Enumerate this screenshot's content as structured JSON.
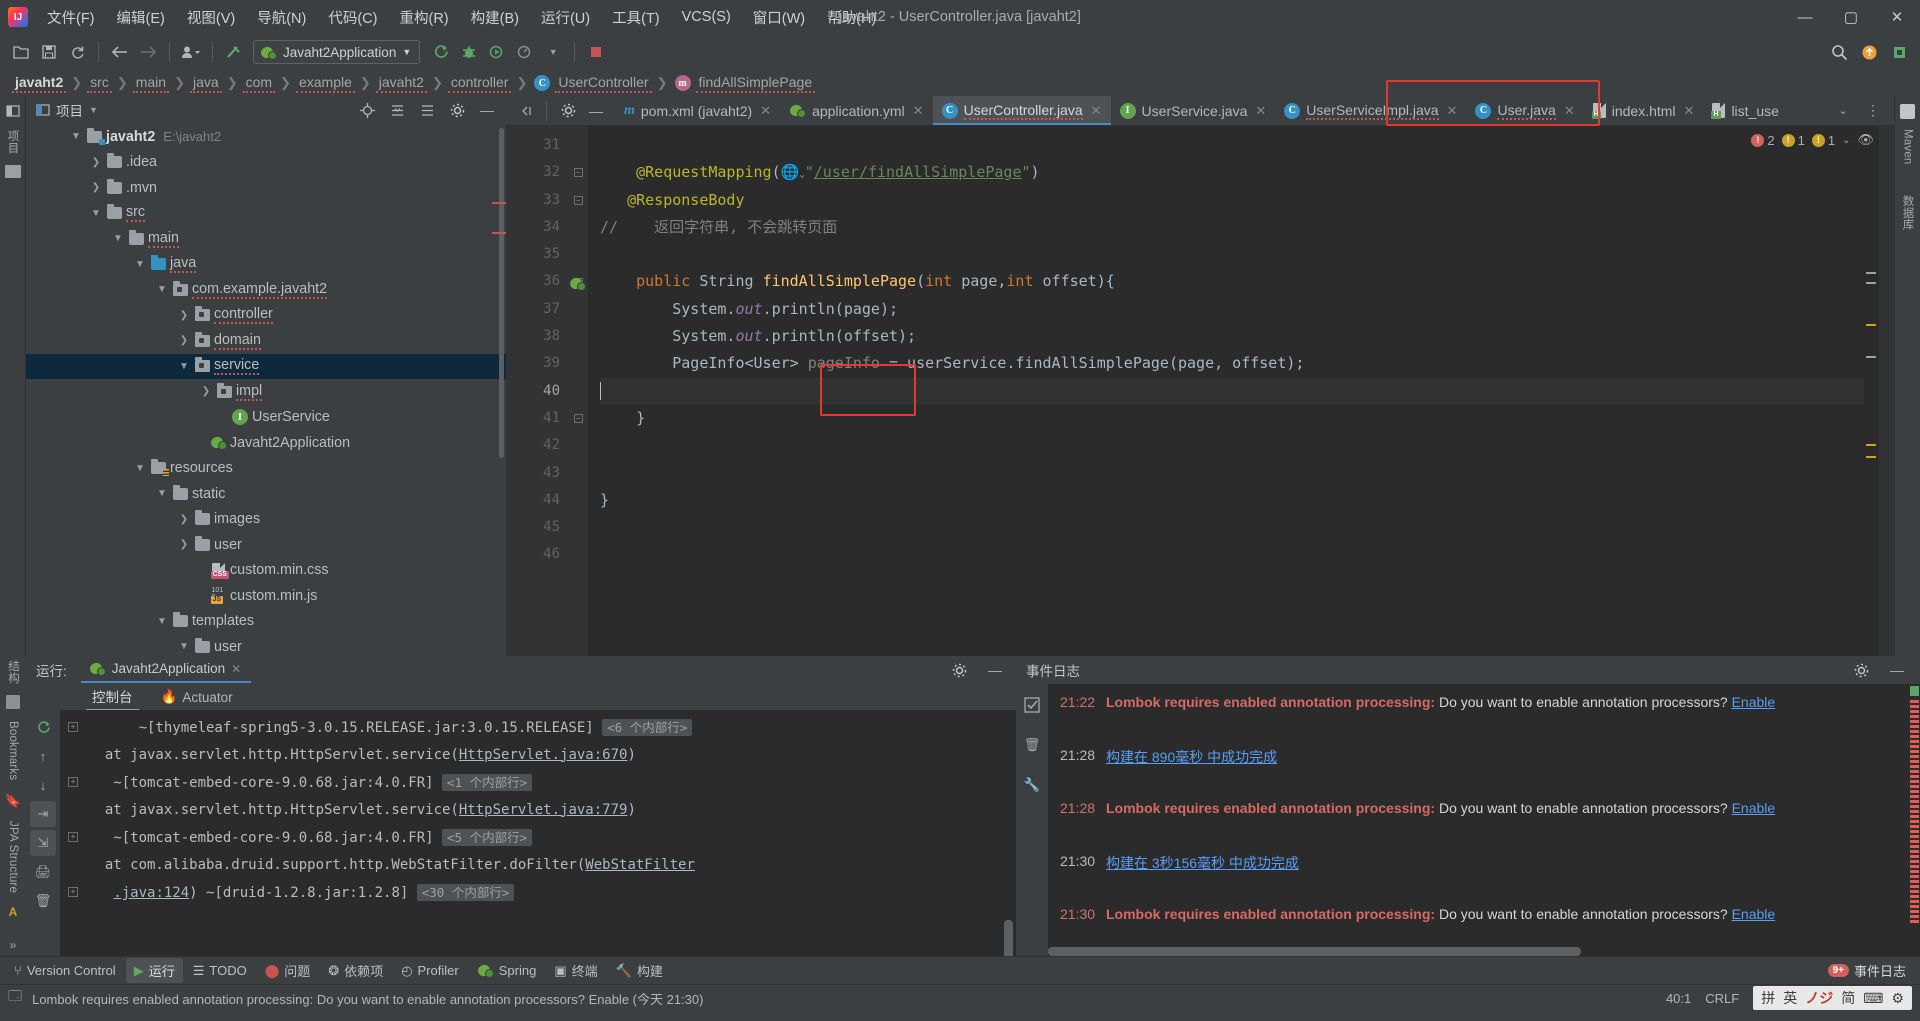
{
  "window": {
    "title": "javaht2 - UserController.java [javaht2]",
    "minimize": "—",
    "maximize": "▢",
    "close": "✕"
  },
  "menu": [
    {
      "label": "文件(F)"
    },
    {
      "label": "编辑(E)"
    },
    {
      "label": "视图(V)"
    },
    {
      "label": "导航(N)"
    },
    {
      "label": "代码(C)"
    },
    {
      "label": "重构(R)"
    },
    {
      "label": "构建(B)"
    },
    {
      "label": "运行(U)"
    },
    {
      "label": "工具(T)"
    },
    {
      "label": "VCS(S)"
    },
    {
      "label": "窗口(W)"
    },
    {
      "label": "帮助(H)"
    }
  ],
  "toolbar": {
    "run_config": "Javaht2Application",
    "icons": [
      "open-folder-icon",
      "save-icon",
      "sync-icon",
      "back-icon",
      "forward-icon",
      "profile-icon",
      "build-hammer-icon",
      "run-icon",
      "debug-icon",
      "run-coverage-icon",
      "profiler-icon",
      "stop-icon"
    ],
    "right_icons": [
      "search-icon",
      "updates-icon",
      "plugin-icon"
    ]
  },
  "breadcrumb": [
    {
      "label": "javaht2",
      "bold": true
    },
    {
      "label": "src"
    },
    {
      "label": "main"
    },
    {
      "label": "java"
    },
    {
      "label": "com"
    },
    {
      "label": "example"
    },
    {
      "label": "javaht2"
    },
    {
      "label": "controller"
    },
    {
      "label": "UserController",
      "icon": "class-icon"
    },
    {
      "label": "findAllSimplePage",
      "icon": "method-icon"
    }
  ],
  "project_panel": {
    "title": "项目",
    "tree": [
      {
        "depth": 0,
        "label": "javaht2",
        "suffix": "E:\\javaht2",
        "arrow": "down",
        "icon": "module-folder-icon",
        "bold": true
      },
      {
        "depth": 1,
        "label": ".idea",
        "arrow": "right",
        "icon": "folder-icon"
      },
      {
        "depth": 1,
        "label": ".mvn",
        "arrow": "right",
        "icon": "folder-icon"
      },
      {
        "depth": 1,
        "label": "src",
        "arrow": "down",
        "icon": "folder-icon"
      },
      {
        "depth": 2,
        "label": "main",
        "arrow": "down",
        "icon": "folder-icon"
      },
      {
        "depth": 3,
        "label": "java",
        "arrow": "down",
        "icon": "source-folder-icon"
      },
      {
        "depth": 4,
        "label": "com.example.javaht2",
        "arrow": "down",
        "icon": "package-icon"
      },
      {
        "depth": 5,
        "label": "controller",
        "arrow": "right",
        "icon": "package-icon"
      },
      {
        "depth": 5,
        "label": "domain",
        "arrow": "right",
        "icon": "package-icon"
      },
      {
        "depth": 5,
        "label": "service",
        "arrow": "down",
        "icon": "package-icon",
        "selected": true
      },
      {
        "depth": 6,
        "label": "impl",
        "arrow": "right",
        "icon": "package-icon"
      },
      {
        "depth": 6,
        "label": "UserService",
        "arrow": "none",
        "icon": "interface-icon"
      },
      {
        "depth": 5,
        "label": "Javaht2Application",
        "arrow": "none",
        "icon": "spring-boot-icon"
      },
      {
        "depth": 3,
        "label": "resources",
        "arrow": "down",
        "icon": "resources-folder-icon"
      },
      {
        "depth": 4,
        "label": "static",
        "arrow": "down",
        "icon": "folder-icon"
      },
      {
        "depth": 5,
        "label": "images",
        "arrow": "right",
        "icon": "folder-icon"
      },
      {
        "depth": 5,
        "label": "user",
        "arrow": "right",
        "icon": "folder-icon"
      },
      {
        "depth": 5,
        "label": "custom.min.css",
        "arrow": "none",
        "icon": "css-file-icon"
      },
      {
        "depth": 5,
        "label": "custom.min.js",
        "arrow": "none",
        "icon": "js-file-icon"
      },
      {
        "depth": 4,
        "label": "templates",
        "arrow": "down",
        "icon": "folder-icon"
      },
      {
        "depth": 5,
        "label": "user",
        "arrow": "down",
        "icon": "folder-icon"
      }
    ]
  },
  "editor_tabs": [
    {
      "label": "pom.xml (javaht2)",
      "icon": "maven-icon",
      "active": false
    },
    {
      "label": "application.yml",
      "icon": "spring-icon",
      "active": false
    },
    {
      "label": "UserController.java",
      "icon": "class-icon",
      "active": true,
      "highlighted": true
    },
    {
      "label": "UserService.java",
      "icon": "interface-icon",
      "active": false
    },
    {
      "label": "UserServiceImpl.java",
      "icon": "class-icon",
      "active": false
    },
    {
      "label": "User.java",
      "icon": "class-icon",
      "active": false
    },
    {
      "label": "index.html",
      "icon": "html-file-icon",
      "active": false
    },
    {
      "label": "list_use",
      "icon": "html-file-icon",
      "active": false
    }
  ],
  "editor": {
    "inspections": {
      "errors": "2",
      "warnings": "1",
      "weak_warnings": "1"
    },
    "lines": [
      {
        "num": "31",
        "tokens": []
      },
      {
        "num": "32",
        "fold": true,
        "tokens": [
          {
            "t": "    ",
            "c": "pm"
          },
          {
            "t": "@RequestMapping",
            "c": "an"
          },
          {
            "t": "(",
            "c": "pm"
          },
          {
            "t": "globe",
            "c": "icon"
          },
          {
            "t": "\"",
            "c": "st"
          },
          {
            "t": "/user/findAllSimplePage",
            "c": "ln"
          },
          {
            "t": "\"",
            "c": "st"
          },
          {
            "t": ")",
            "c": "pm"
          }
        ]
      },
      {
        "num": "33",
        "fold": true,
        "tokens": [
          {
            "t": "   ",
            "c": "pm"
          },
          {
            "t": "@ResponseBody",
            "c": "an"
          }
        ]
      },
      {
        "num": "34",
        "tokens": [
          {
            "t": "//    返回字符串, 不会跳转页面",
            "c": "cm"
          }
        ]
      },
      {
        "num": "35",
        "tokens": []
      },
      {
        "num": "36",
        "fold": true,
        "gutter_icon": "spring-bean-icon",
        "tokens": [
          {
            "t": "    ",
            "c": "pm"
          },
          {
            "t": "public ",
            "c": "k"
          },
          {
            "t": "String ",
            "c": "pm"
          },
          {
            "t": "findAllSimplePage",
            "c": "fn"
          },
          {
            "t": "(",
            "c": "pm"
          },
          {
            "t": "int ",
            "c": "k"
          },
          {
            "t": "page,",
            "c": "pm"
          },
          {
            "t": "int ",
            "c": "k"
          },
          {
            "t": "offset){",
            "c": "pm"
          }
        ]
      },
      {
        "num": "37",
        "tokens": [
          {
            "t": "        System.",
            "c": "pm"
          },
          {
            "t": "out",
            "c": "fi"
          },
          {
            "t": ".println(page);",
            "c": "pm"
          }
        ]
      },
      {
        "num": "38",
        "tokens": [
          {
            "t": "        System.",
            "c": "pm"
          },
          {
            "t": "out",
            "c": "fi"
          },
          {
            "t": ".println(offset);",
            "c": "pm"
          }
        ]
      },
      {
        "num": "39",
        "tokens": [
          {
            "t": "        PageInfo<User> ",
            "c": "pm"
          },
          {
            "t": "pageInfo",
            "c": "cm"
          },
          {
            "t": " = userService.findAllSimplePage(page, offset);",
            "c": "pm"
          }
        ]
      },
      {
        "num": "40",
        "current": true,
        "caret": true,
        "tokens": []
      },
      {
        "num": "41",
        "fold": true,
        "tokens": [
          {
            "t": "    }",
            "c": "pm"
          }
        ]
      },
      {
        "num": "42",
        "tokens": []
      },
      {
        "num": "43",
        "tokens": []
      },
      {
        "num": "44",
        "tokens": [
          {
            "t": "}",
            "c": "pm"
          }
        ]
      },
      {
        "num": "45",
        "tokens": []
      },
      {
        "num": "46",
        "tokens": []
      }
    ]
  },
  "run_panel": {
    "label": "运行:",
    "tab": "Javaht2Application",
    "subtabs": [
      {
        "label": "控制台",
        "active": true
      },
      {
        "label": "Actuator",
        "active": false,
        "icon": "actuator-icon"
      }
    ],
    "console": [
      {
        "indent": "      ",
        "pre": "~[thymeleaf-spring5-3.0.15.RELEASE.jar:3.0.15.RELEASE]",
        "chip": "<6 个内部行>",
        "plus": true
      },
      {
        "indent": "  ",
        "pre": "at javax.servlet.http.HttpServlet.service(",
        "link": "HttpServlet.java:670",
        "post": ")"
      },
      {
        "indent": "   ",
        "pre": "~[tomcat-embed-core-9.0.68.jar:4.0.FR]",
        "chip": "<1 个内部行>",
        "plus": true
      },
      {
        "indent": "  ",
        "pre": "at javax.servlet.http.HttpServlet.service(",
        "link": "HttpServlet.java:779",
        "post": ")"
      },
      {
        "indent": "   ",
        "pre": "~[tomcat-embed-core-9.0.68.jar:4.0.FR]",
        "chip": "<5 个内部行>",
        "plus": true
      },
      {
        "indent": "  ",
        "pre": "at com.alibaba.druid.support.http.WebStatFilter.doFilter(",
        "link": "WebStatFilter",
        "post": ""
      },
      {
        "indent": "   ",
        "link": ".java:124",
        "pre2": ") ~[druid-1.2.8.jar:1.2.8] ",
        "chip": "<30 个内部行>",
        "plus": true
      }
    ]
  },
  "event_log": {
    "title": "事件日志",
    "entries": [
      {
        "time": "21:22",
        "bold": "Lombok requires enabled annotation processing:",
        "text": " Do you want to enable annotation processors? ",
        "link": "Enable",
        "type": "error"
      },
      {
        "time": "21:28",
        "link_text": "构建在 890毫秒 中成功完成",
        "type": "info"
      },
      {
        "time": "21:28",
        "bold": "Lombok requires enabled annotation processing:",
        "text": " Do you want to enable annotation processors? ",
        "link": "Enable",
        "type": "error"
      },
      {
        "time": "21:30",
        "link_text": "构建在 3秒156毫秒 中成功完成",
        "type": "info"
      },
      {
        "time": "21:30",
        "bold": "Lombok requires enabled annotation processing:",
        "text": " Do you want to enable annotation processors? ",
        "link": "Enable",
        "type": "error"
      }
    ]
  },
  "tool_window_bar": {
    "left": [
      {
        "label": "Version Control",
        "icon": "branch-icon"
      },
      {
        "label": "运行",
        "icon": "run-icon",
        "active": true
      },
      {
        "label": "TODO",
        "icon": "todo-icon"
      },
      {
        "label": "问题",
        "icon": "problems-icon"
      },
      {
        "label": "依赖项",
        "icon": "dependencies-icon"
      },
      {
        "label": "Profiler",
        "icon": "profiler-icon"
      },
      {
        "label": "Spring",
        "icon": "spring-icon"
      },
      {
        "label": "终端",
        "icon": "terminal-icon"
      },
      {
        "label": "构建",
        "icon": "build-icon"
      }
    ],
    "right": [
      {
        "label": "事件日志",
        "icon": "event-log-icon",
        "badge": "9+"
      }
    ]
  },
  "left_tool_strip": [
    {
      "label": "项目",
      "name": "project-tool-button"
    },
    {
      "label": "结构",
      "name": "structure-tool-button"
    },
    {
      "label": "Bookmarks",
      "name": "bookmarks-tool-button"
    },
    {
      "label": "JPA Structure",
      "name": "jpa-structure-tool-button"
    }
  ],
  "right_tool_strip": [
    {
      "label": "Maven",
      "name": "maven-tool-button"
    },
    {
      "label": "数据库",
      "name": "database-tool-button"
    }
  ],
  "status_bar": {
    "message": "Lombok requires enabled annotation processing: Do you want to enable annotation processors? Enable (今天 21:30)",
    "caret_position": "40:1",
    "line_separator": "CRLF",
    "ime": [
      "拼",
      "英",
      "ノジ",
      "简",
      "⌨",
      "⚙"
    ]
  }
}
